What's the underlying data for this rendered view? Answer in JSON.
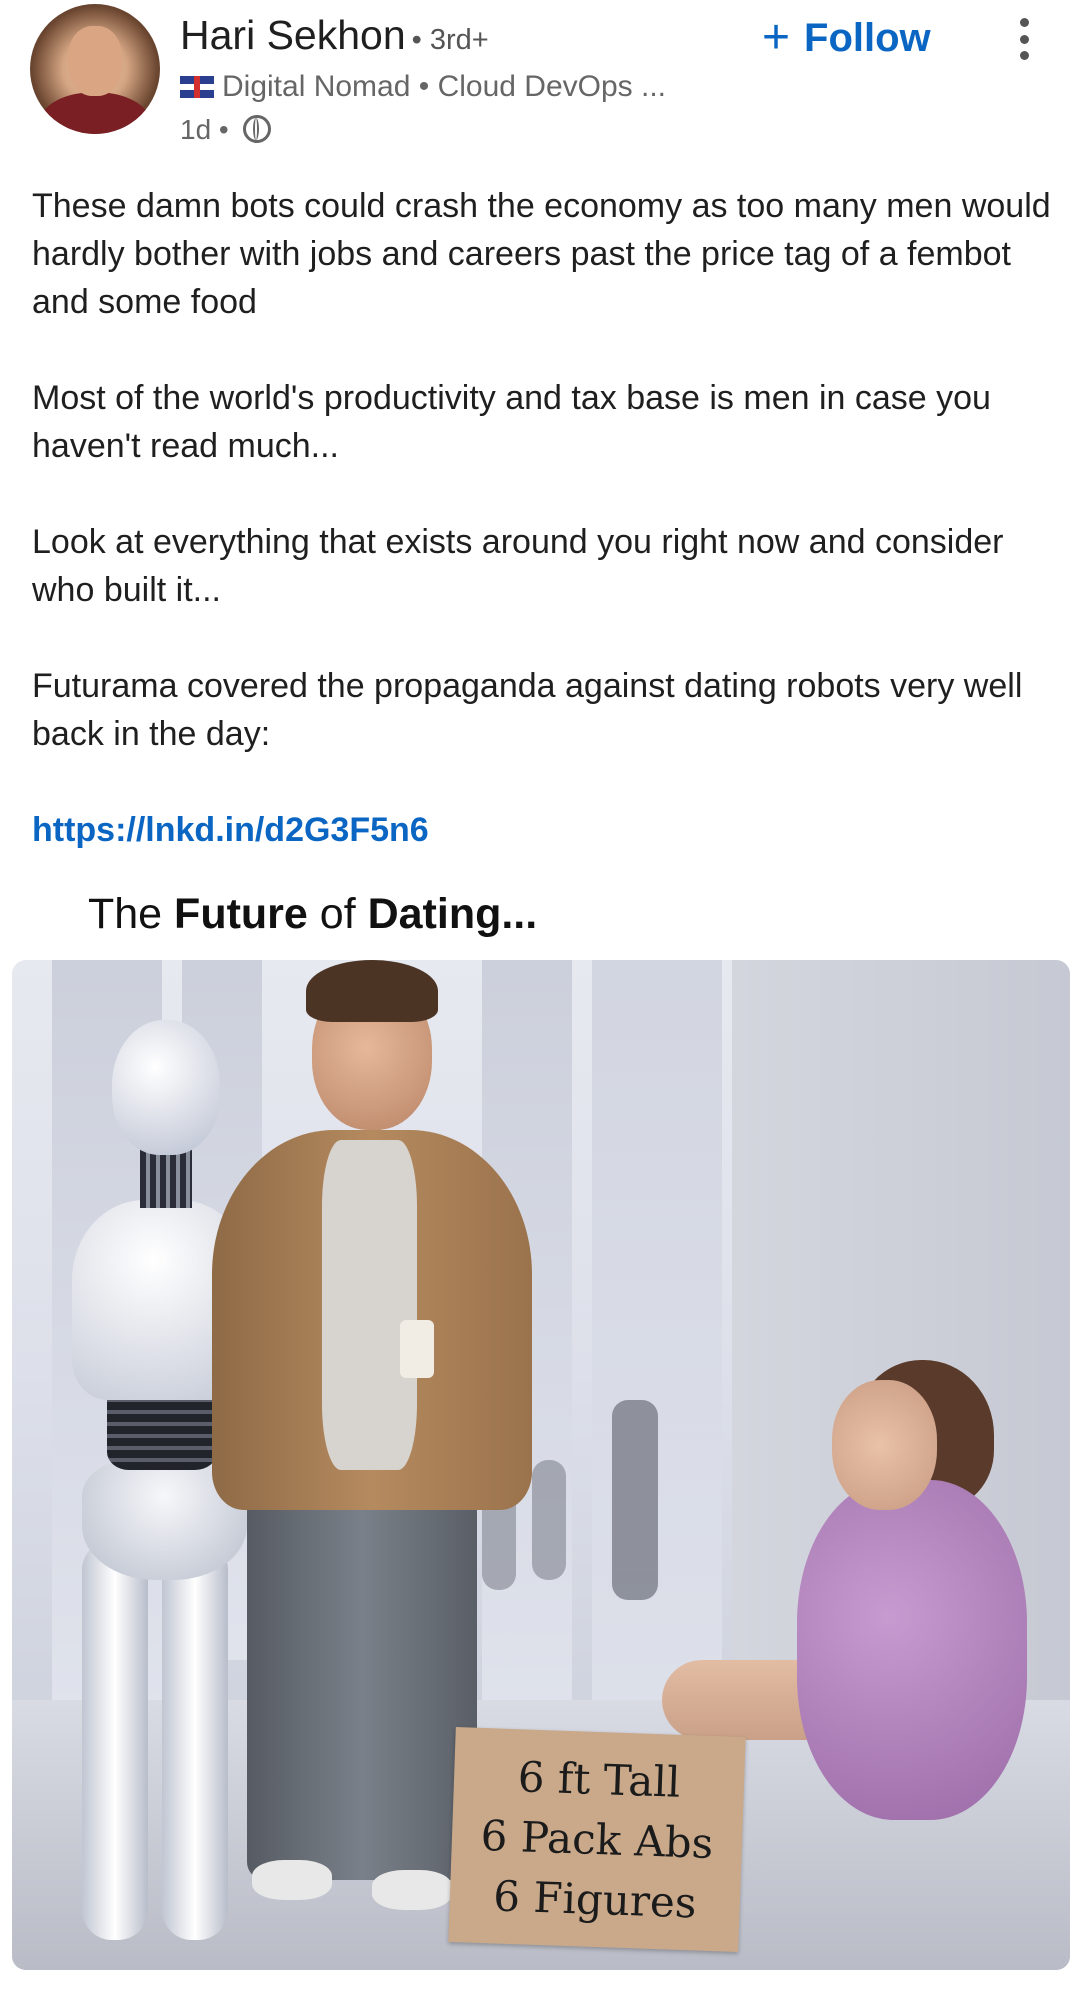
{
  "author": {
    "name": "Hari Sekhon",
    "degree": "• 3rd+",
    "headline": "Digital Nomad • Cloud DevOps ...",
    "flag_icon": "uk-flag-icon",
    "time": "1d •",
    "visibility_icon": "globe-icon",
    "avatar_icon": "profile-photo"
  },
  "actions": {
    "follow_icon": "+",
    "follow_label": "Follow",
    "more_icon": "more-vertical-icon"
  },
  "post": {
    "paragraphs": [
      "These damn bots could crash the economy as too many men would hardly bother with jobs and careers past the price tag of a fembot and some food",
      "Most of the world's productivity and tax base is men in case you haven't read much...",
      "Look at everything that exists around you right now and consider who built it...",
      "Futurama covered the propaganda against dating robots very well back in the day:"
    ],
    "link": "https://lnkd.in/d2G3F5n6"
  },
  "meme": {
    "title_prefix": "The ",
    "title_bold": "Future",
    "title_middle": " of ",
    "title_bold2": "Dating...",
    "sign_lines": [
      "6 ft Tall",
      "6 Pack Abs",
      "6 Figures"
    ]
  },
  "colors": {
    "link_blue": "#0a66c2",
    "text_primary": "#1f1f1f",
    "text_secondary": "#666666"
  }
}
